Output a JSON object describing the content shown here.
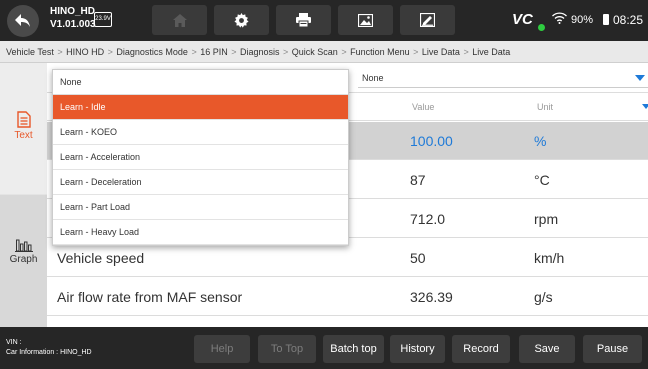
{
  "header": {
    "app_name": "HINO_HD",
    "version": "V1.01.003",
    "voltage": "23.9V",
    "vci_label": "VC",
    "battery": "90%",
    "time": "08:25",
    "icons": [
      "back-icon",
      "home-icon",
      "settings-icon",
      "print-icon",
      "screenshot-icon",
      "save-report-icon",
      "wifi-icon",
      "battery-icon"
    ]
  },
  "breadcrumb": [
    "Vehicle Test",
    "HINO HD",
    "Diagnostics Mode",
    "16 PIN",
    "Diagnosis",
    "Quick Scan",
    "Function Menu",
    "Live Data",
    "Live Data"
  ],
  "sidebar": {
    "text_label": "Text",
    "graph_label": "Graph"
  },
  "filters": {
    "first": "None",
    "second": "None"
  },
  "dropdown": {
    "items": [
      "Learn - Idle",
      "Learn - KOEO",
      "Learn - Acceleration",
      "Learn - Deceleration",
      "Learn - Part Load",
      "Learn - Heavy Load"
    ],
    "selected": "Learn - Idle"
  },
  "table": {
    "columns": {
      "value": "Value",
      "unit": "Unit"
    },
    "rows": [
      {
        "name": "",
        "value": "100.00",
        "unit": "%"
      },
      {
        "name": "",
        "value": "87",
        "unit": "°C"
      },
      {
        "name": "",
        "value": "712.0",
        "unit": "rpm"
      },
      {
        "name": "Vehicle speed",
        "value": "50",
        "unit": "km/h"
      },
      {
        "name": "Air flow rate from MAF sensor",
        "value": "326.39",
        "unit": "g/s"
      }
    ]
  },
  "footer": {
    "vin_label": "VIN :",
    "car_info": "Car Information : HINO_HD",
    "buttons": {
      "help": "Help",
      "to_top": "To Top",
      "batch_top": "Batch top",
      "history": "History",
      "record": "Record",
      "save": "Save",
      "pause": "Pause"
    }
  },
  "colors": {
    "accent": "#e8582a",
    "blue": "#1e7ad8",
    "bar": "#262626"
  }
}
